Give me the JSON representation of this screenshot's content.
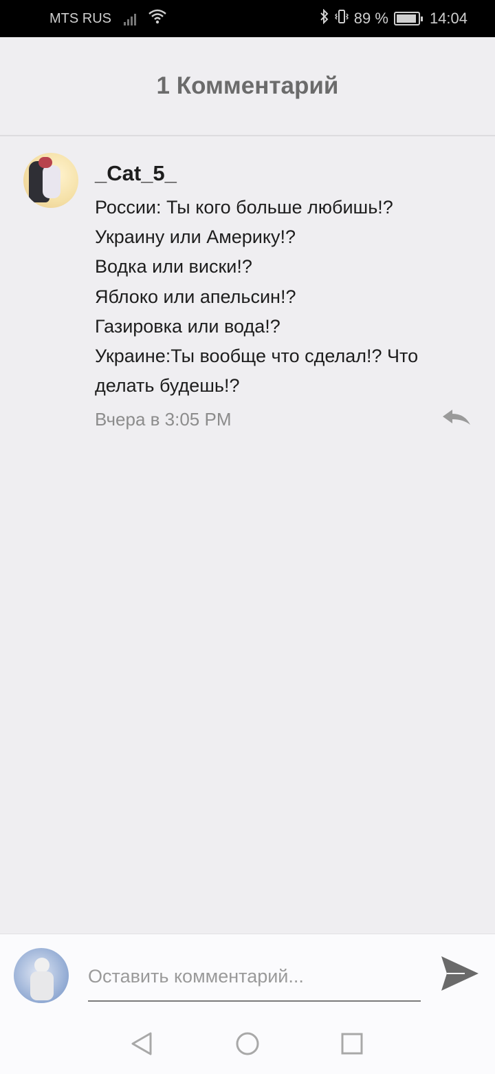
{
  "status_bar": {
    "carrier": "MTS RUS",
    "battery_text": "89 %",
    "time": "14:04",
    "icons": [
      "signal-icon",
      "wifi-icon",
      "bluetooth-icon",
      "vibrate-icon",
      "battery-icon"
    ]
  },
  "header": {
    "title": "1 Комментарий"
  },
  "comment": {
    "author": "_Cat_5_",
    "lines": [
      "России: Ты кого больше любишь!?",
      "Украину или Америку!?",
      "Водка или виски!?",
      "Яблоко или апельсин!?",
      "Газировка или вода!?",
      "Украине:Ты вообще что сделал!? Что",
      "делать будешь!?"
    ],
    "timestamp": "Вчера в 3:05 PM",
    "reply_icon": "reply-icon"
  },
  "input_bar": {
    "placeholder": "Оставить комментарий...",
    "send_icon": "send-icon"
  },
  "nav_bar": {
    "icons": [
      "back-icon",
      "home-icon",
      "recents-icon"
    ]
  },
  "colors": {
    "background": "#efeef1",
    "status_bar": "#000000",
    "title_text": "#6b6b6b",
    "body_text": "#1d1d1d",
    "muted_text": "#8c8c8c"
  }
}
